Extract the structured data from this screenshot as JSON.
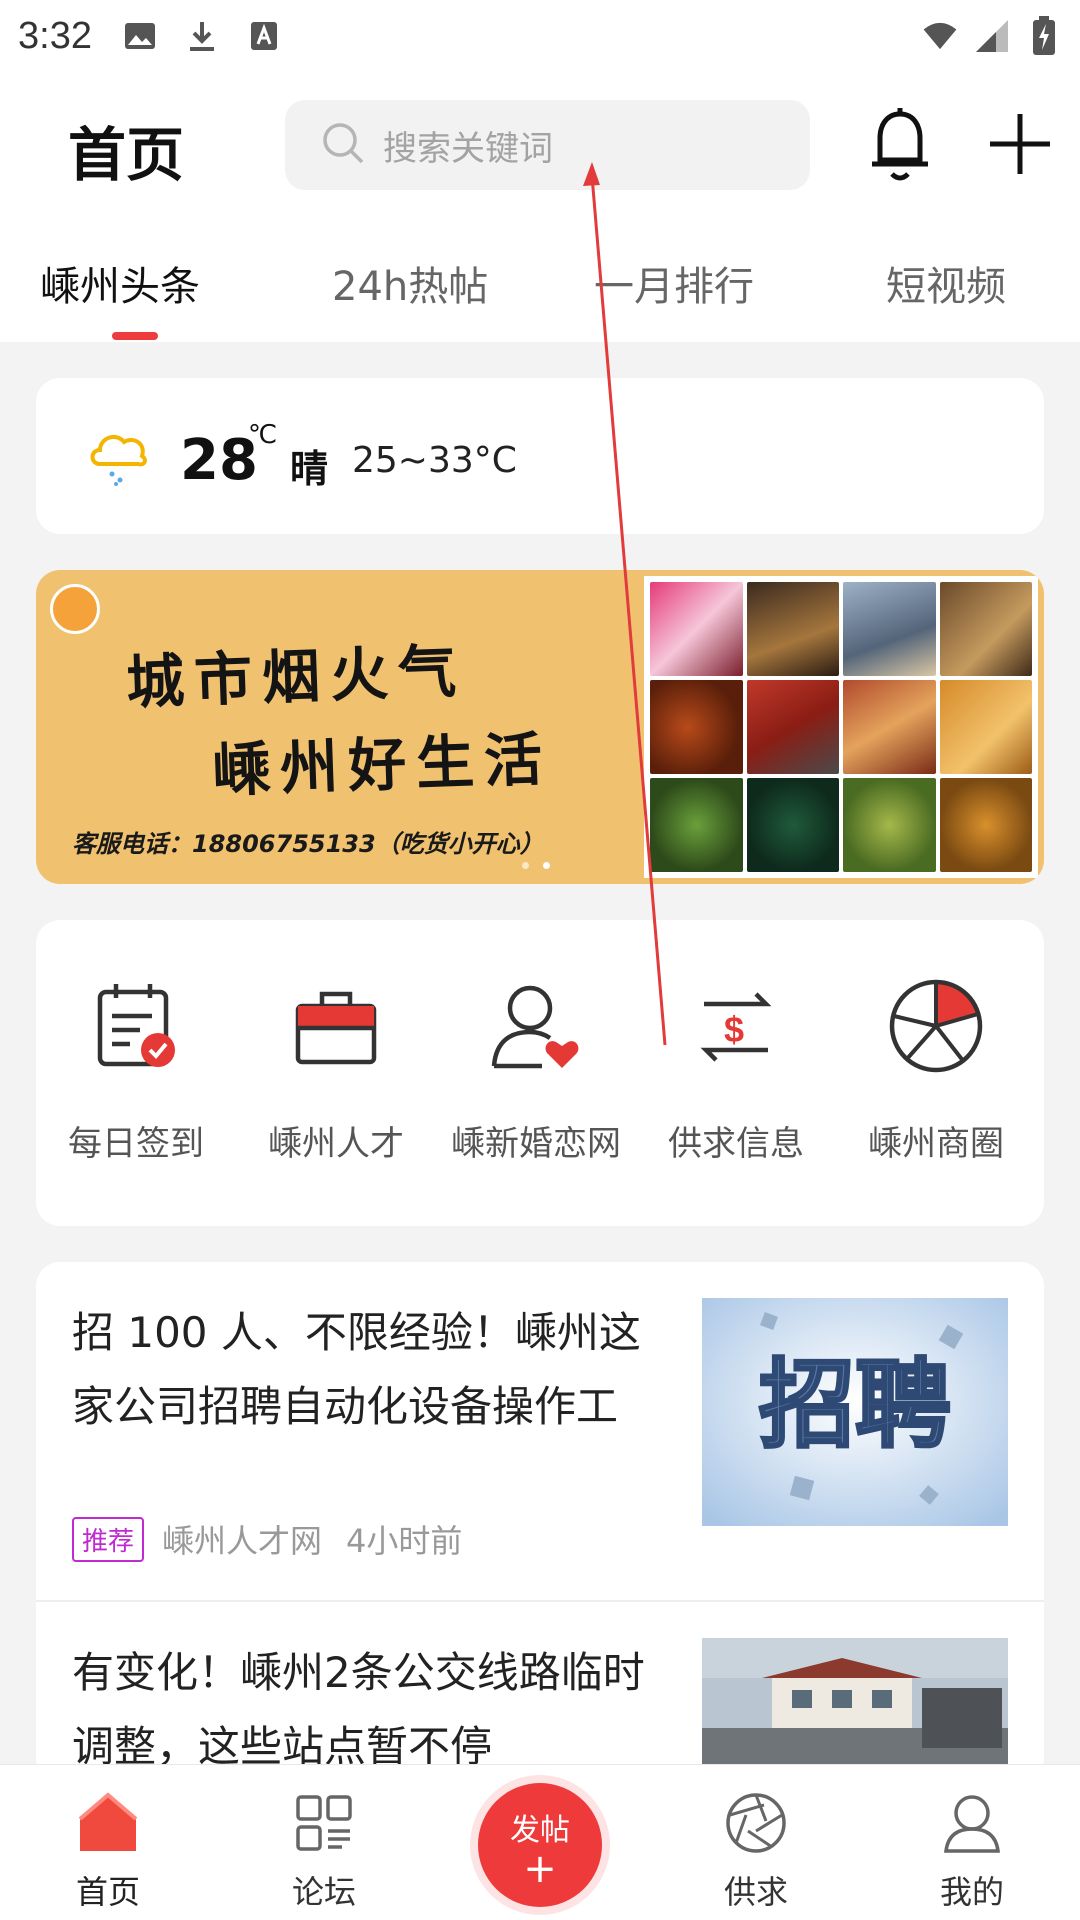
{
  "status_bar": {
    "time": "3:32"
  },
  "header": {
    "title": "首页",
    "search_placeholder": "搜索关键词"
  },
  "tabs": [
    {
      "label": "嵊州头条",
      "active": true
    },
    {
      "label": "24h热帖",
      "active": false
    },
    {
      "label": "一月排行",
      "active": false
    },
    {
      "label": "短视频",
      "active": false
    }
  ],
  "weather": {
    "temperature": "28",
    "unit": "℃",
    "condition": "晴",
    "range": "25~33°C"
  },
  "banner": {
    "line1": "城市烟火气",
    "line2": "嵊州好生活",
    "phone": "客服电话：18806755133（吃货小开心）",
    "slide_count": 2,
    "active_slide": 2
  },
  "quick_menu": [
    {
      "label": "每日签到",
      "icon": "calendar-check-icon"
    },
    {
      "label": "嵊州人才",
      "icon": "toolbox-icon"
    },
    {
      "label": "嵊新婚恋网",
      "icon": "user-heart-icon"
    },
    {
      "label": "供求信息",
      "icon": "exchange-dollar-icon"
    },
    {
      "label": "嵊州商圈",
      "icon": "pie-aperture-icon"
    }
  ],
  "news": [
    {
      "title": "招 100 人、不限经验！嵊州这家公司招聘自动化设备操作工",
      "tag": "推荐",
      "source": "嵊州人才网",
      "time": "4小时前",
      "thumb_text": "招聘"
    },
    {
      "title": "有变化！嵊州2条公交线路临时调整，这些站点暂不停"
    }
  ],
  "bottom_nav": [
    {
      "label": "首页",
      "icon": "home-icon",
      "active": true
    },
    {
      "label": "论坛",
      "icon": "forum-icon",
      "active": false
    },
    {
      "label": "发帖",
      "icon": "post-plus-icon",
      "active": false
    },
    {
      "label": "供求",
      "icon": "aperture-icon",
      "active": false
    },
    {
      "label": "我的",
      "icon": "user-icon",
      "active": false
    }
  ],
  "colors": {
    "accent": "#ee3a3a",
    "tag": "#c02ad0",
    "banner_bg": "#f0c270"
  }
}
